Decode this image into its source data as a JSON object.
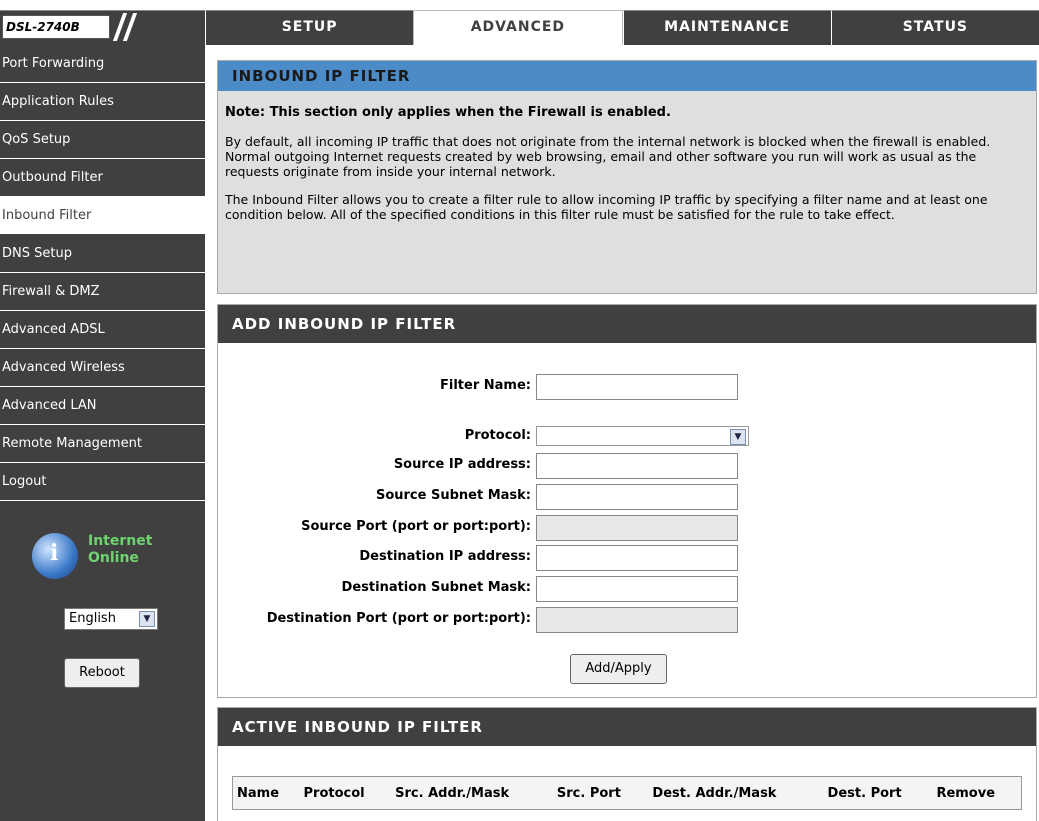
{
  "brand": {
    "model": "DSL-2740B"
  },
  "tabs": [
    {
      "label": "SETUP",
      "active": false
    },
    {
      "label": "ADVANCED",
      "active": true
    },
    {
      "label": "MAINTENANCE",
      "active": false
    },
    {
      "label": "STATUS",
      "active": false
    }
  ],
  "sidebar": {
    "items": [
      {
        "label": "Port Forwarding",
        "active": false
      },
      {
        "label": "Application Rules",
        "active": false
      },
      {
        "label": "QoS Setup",
        "active": false
      },
      {
        "label": "Outbound Filter",
        "active": false
      },
      {
        "label": "Inbound Filter",
        "active": true
      },
      {
        "label": "DNS Setup",
        "active": false
      },
      {
        "label": "Firewall & DMZ",
        "active": false
      },
      {
        "label": "Advanced ADSL",
        "active": false
      },
      {
        "label": "Advanced Wireless",
        "active": false
      },
      {
        "label": "Advanced LAN",
        "active": false
      },
      {
        "label": "Remote Management",
        "active": false
      },
      {
        "label": "Logout",
        "active": false
      }
    ],
    "status_line1": "Internet",
    "status_line2": "Online",
    "status_color": "#6fd36f",
    "language": "English",
    "reboot_label": "Reboot"
  },
  "intro": {
    "title": "INBOUND IP FILTER",
    "note": "Note: This section only applies when the Firewall is enabled.",
    "para1": "By default, all incoming IP traffic that does not originate from the internal network is blocked when the firewall is enabled. Normal outgoing Internet requests created by web browsing, email and other software you run will work as usual as the requests originate from inside your internal network.",
    "para2": "The Inbound Filter allows you to create a filter rule to allow incoming IP traffic by specifying a filter name and at least one condition below. All of the specified conditions in this filter rule must be satisfied for the rule to take effect."
  },
  "add": {
    "title": "ADD INBOUND IP FILTER",
    "fields": {
      "filter_name": {
        "label": "Filter Name:",
        "value": ""
      },
      "protocol": {
        "label": "Protocol:",
        "value": ""
      },
      "src_ip": {
        "label": "Source IP address:",
        "value": ""
      },
      "src_mask": {
        "label": "Source Subnet Mask:",
        "value": ""
      },
      "src_port": {
        "label": "Source Port (port or port:port):",
        "value": "",
        "disabled": true
      },
      "dst_ip": {
        "label": "Destination IP address:",
        "value": ""
      },
      "dst_mask": {
        "label": "Destination Subnet Mask:",
        "value": ""
      },
      "dst_port": {
        "label": "Destination Port (port or port:port):",
        "value": "",
        "disabled": true
      }
    },
    "apply_label": "Add/Apply"
  },
  "active": {
    "title": "ACTIVE INBOUND IP FILTER",
    "columns": [
      "Name",
      "Protocol",
      "Src. Addr./Mask",
      "Src. Port",
      "Dest. Addr./Mask",
      "Dest. Port",
      "Remove"
    ]
  },
  "colors": {
    "dark": "#404040",
    "header_blue": "#4b8cc8",
    "panel_gray": "#dfdfdf"
  }
}
